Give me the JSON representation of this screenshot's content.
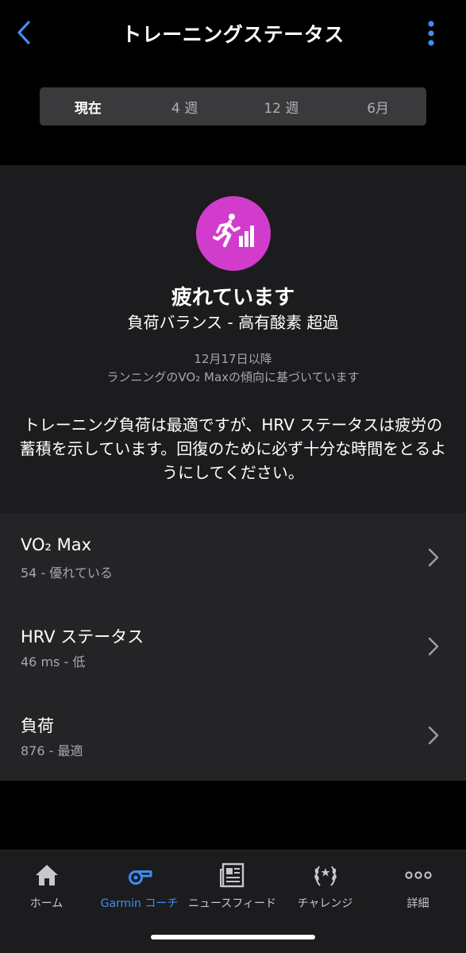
{
  "header": {
    "title": "トレーニングステータス",
    "back_icon": "chevron-left-icon",
    "menu_icon": "more-vertical-icon",
    "accent_color": "#3d8ef0"
  },
  "range_tabs": [
    {
      "label": "現在",
      "selected": true
    },
    {
      "label": "4 週",
      "selected": false
    },
    {
      "label": "12 週",
      "selected": false
    },
    {
      "label": "6月",
      "selected": false
    }
  ],
  "status": {
    "icon": "running-productive-icon",
    "icon_color": "#d23ccd",
    "title": "疲れています",
    "subtitle": "負荷バランス - 高有酸素 超過",
    "since": "12月17日以降",
    "basis": "ランニングのVO₂ Maxの傾向に基づいています",
    "description": "トレーニング負荷は最適ですが、HRV ステータスは疲労の蓄積を示しています。回復のために必ず十分な時間をとるようにしてください。"
  },
  "metrics": [
    {
      "name": "VO₂ Max",
      "value": "54 - 優れている"
    },
    {
      "name": "HRV ステータス",
      "value": "46 ms - 低"
    },
    {
      "name": "負荷",
      "value": "876 - 最適"
    }
  ],
  "tabbar": [
    {
      "label": "ホーム",
      "icon": "home-icon",
      "active": false
    },
    {
      "label": "Garmin コーチ",
      "icon": "whistle-icon",
      "active": true
    },
    {
      "label": "ニュースフィード",
      "icon": "newspaper-icon",
      "active": false
    },
    {
      "label": "チャレンジ",
      "icon": "laurel-icon",
      "active": false
    },
    {
      "label": "詳細",
      "icon": "more-horizontal-icon",
      "active": false
    }
  ]
}
